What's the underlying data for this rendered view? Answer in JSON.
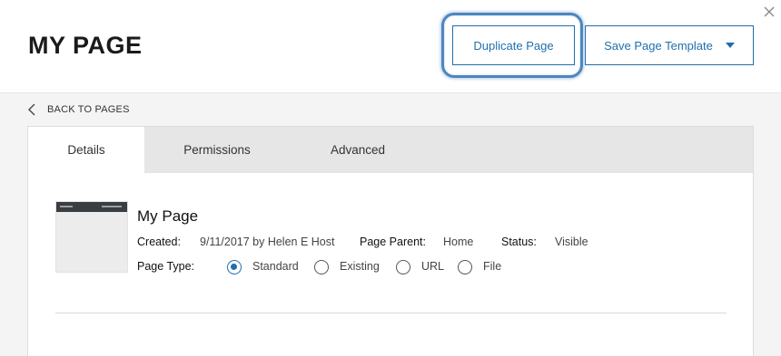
{
  "header": {
    "title": "MY PAGE",
    "duplicate_label": "Duplicate Page",
    "template_label": "Save Page Template",
    "accent_color": "#1f6fae"
  },
  "nav": {
    "back_label": "BACK TO PAGES"
  },
  "tabs": [
    {
      "label": "Details",
      "active": true
    },
    {
      "label": "Permissions",
      "active": false
    },
    {
      "label": "Advanced",
      "active": false
    }
  ],
  "details": {
    "page_name": "My Page",
    "created_label": "Created:",
    "created_value": "9/11/2017 by Helen E Host",
    "parent_label": "Page Parent:",
    "parent_value": "Home",
    "status_label": "Status:",
    "status_value": "Visible",
    "type_label": "Page Type:",
    "page_types": [
      "Standard",
      "Existing",
      "URL",
      "File"
    ],
    "selected_type": "Standard"
  },
  "icons": [
    "close-icon",
    "chevron-left-icon",
    "caret-down-icon"
  ]
}
